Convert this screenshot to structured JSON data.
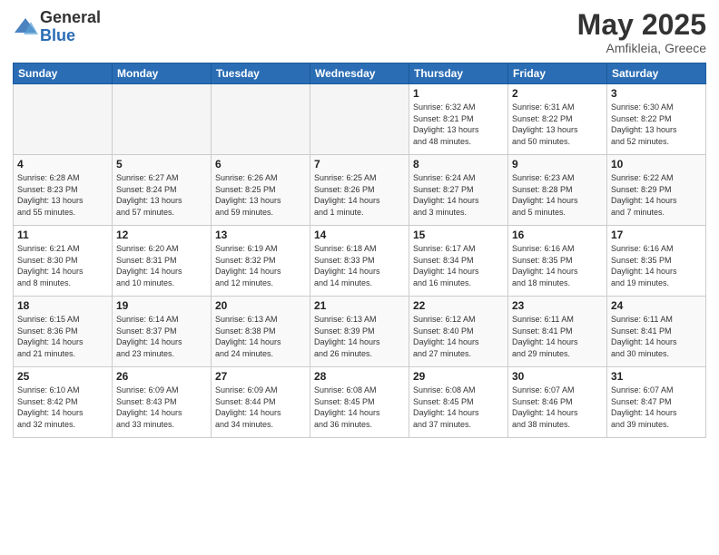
{
  "logo": {
    "general": "General",
    "blue": "Blue"
  },
  "title": {
    "month_year": "May 2025",
    "location": "Amfikleia, Greece"
  },
  "headers": [
    "Sunday",
    "Monday",
    "Tuesday",
    "Wednesday",
    "Thursday",
    "Friday",
    "Saturday"
  ],
  "weeks": [
    [
      {
        "day": "",
        "info": ""
      },
      {
        "day": "",
        "info": ""
      },
      {
        "day": "",
        "info": ""
      },
      {
        "day": "",
        "info": ""
      },
      {
        "day": "1",
        "info": "Sunrise: 6:32 AM\nSunset: 8:21 PM\nDaylight: 13 hours\nand 48 minutes."
      },
      {
        "day": "2",
        "info": "Sunrise: 6:31 AM\nSunset: 8:22 PM\nDaylight: 13 hours\nand 50 minutes."
      },
      {
        "day": "3",
        "info": "Sunrise: 6:30 AM\nSunset: 8:22 PM\nDaylight: 13 hours\nand 52 minutes."
      }
    ],
    [
      {
        "day": "4",
        "info": "Sunrise: 6:28 AM\nSunset: 8:23 PM\nDaylight: 13 hours\nand 55 minutes."
      },
      {
        "day": "5",
        "info": "Sunrise: 6:27 AM\nSunset: 8:24 PM\nDaylight: 13 hours\nand 57 minutes."
      },
      {
        "day": "6",
        "info": "Sunrise: 6:26 AM\nSunset: 8:25 PM\nDaylight: 13 hours\nand 59 minutes."
      },
      {
        "day": "7",
        "info": "Sunrise: 6:25 AM\nSunset: 8:26 PM\nDaylight: 14 hours\nand 1 minute."
      },
      {
        "day": "8",
        "info": "Sunrise: 6:24 AM\nSunset: 8:27 PM\nDaylight: 14 hours\nand 3 minutes."
      },
      {
        "day": "9",
        "info": "Sunrise: 6:23 AM\nSunset: 8:28 PM\nDaylight: 14 hours\nand 5 minutes."
      },
      {
        "day": "10",
        "info": "Sunrise: 6:22 AM\nSunset: 8:29 PM\nDaylight: 14 hours\nand 7 minutes."
      }
    ],
    [
      {
        "day": "11",
        "info": "Sunrise: 6:21 AM\nSunset: 8:30 PM\nDaylight: 14 hours\nand 8 minutes."
      },
      {
        "day": "12",
        "info": "Sunrise: 6:20 AM\nSunset: 8:31 PM\nDaylight: 14 hours\nand 10 minutes."
      },
      {
        "day": "13",
        "info": "Sunrise: 6:19 AM\nSunset: 8:32 PM\nDaylight: 14 hours\nand 12 minutes."
      },
      {
        "day": "14",
        "info": "Sunrise: 6:18 AM\nSunset: 8:33 PM\nDaylight: 14 hours\nand 14 minutes."
      },
      {
        "day": "15",
        "info": "Sunrise: 6:17 AM\nSunset: 8:34 PM\nDaylight: 14 hours\nand 16 minutes."
      },
      {
        "day": "16",
        "info": "Sunrise: 6:16 AM\nSunset: 8:35 PM\nDaylight: 14 hours\nand 18 minutes."
      },
      {
        "day": "17",
        "info": "Sunrise: 6:16 AM\nSunset: 8:35 PM\nDaylight: 14 hours\nand 19 minutes."
      }
    ],
    [
      {
        "day": "18",
        "info": "Sunrise: 6:15 AM\nSunset: 8:36 PM\nDaylight: 14 hours\nand 21 minutes."
      },
      {
        "day": "19",
        "info": "Sunrise: 6:14 AM\nSunset: 8:37 PM\nDaylight: 14 hours\nand 23 minutes."
      },
      {
        "day": "20",
        "info": "Sunrise: 6:13 AM\nSunset: 8:38 PM\nDaylight: 14 hours\nand 24 minutes."
      },
      {
        "day": "21",
        "info": "Sunrise: 6:13 AM\nSunset: 8:39 PM\nDaylight: 14 hours\nand 26 minutes."
      },
      {
        "day": "22",
        "info": "Sunrise: 6:12 AM\nSunset: 8:40 PM\nDaylight: 14 hours\nand 27 minutes."
      },
      {
        "day": "23",
        "info": "Sunrise: 6:11 AM\nSunset: 8:41 PM\nDaylight: 14 hours\nand 29 minutes."
      },
      {
        "day": "24",
        "info": "Sunrise: 6:11 AM\nSunset: 8:41 PM\nDaylight: 14 hours\nand 30 minutes."
      }
    ],
    [
      {
        "day": "25",
        "info": "Sunrise: 6:10 AM\nSunset: 8:42 PM\nDaylight: 14 hours\nand 32 minutes."
      },
      {
        "day": "26",
        "info": "Sunrise: 6:09 AM\nSunset: 8:43 PM\nDaylight: 14 hours\nand 33 minutes."
      },
      {
        "day": "27",
        "info": "Sunrise: 6:09 AM\nSunset: 8:44 PM\nDaylight: 14 hours\nand 34 minutes."
      },
      {
        "day": "28",
        "info": "Sunrise: 6:08 AM\nSunset: 8:45 PM\nDaylight: 14 hours\nand 36 minutes."
      },
      {
        "day": "29",
        "info": "Sunrise: 6:08 AM\nSunset: 8:45 PM\nDaylight: 14 hours\nand 37 minutes."
      },
      {
        "day": "30",
        "info": "Sunrise: 6:07 AM\nSunset: 8:46 PM\nDaylight: 14 hours\nand 38 minutes."
      },
      {
        "day": "31",
        "info": "Sunrise: 6:07 AM\nSunset: 8:47 PM\nDaylight: 14 hours\nand 39 minutes."
      }
    ]
  ]
}
